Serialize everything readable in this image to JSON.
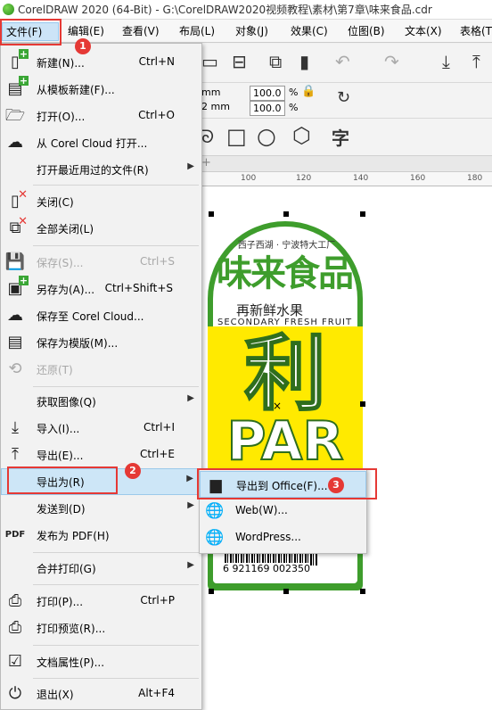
{
  "window": {
    "title": "CorelDRAW 2020 (64-Bit) - G:\\CorelDRAW2020视频教程\\素材\\第7章\\味来食品.cdr"
  },
  "menubar": {
    "items": [
      {
        "label": "文件(F)"
      },
      {
        "label": "编辑(E)"
      },
      {
        "label": "查看(V)"
      },
      {
        "label": "布局(L)"
      },
      {
        "label": "对象(J)"
      },
      {
        "label": "效果(C)"
      },
      {
        "label": "位图(B)"
      },
      {
        "label": "文本(X)"
      },
      {
        "label": "表格(T)"
      }
    ]
  },
  "toolbar": {
    "size_w_unit": "mm",
    "size_h_unit": "2 mm",
    "scale_x": "100.0",
    "scale_y": "100.0",
    "percent": "%",
    "text_tool_glyph": "字"
  },
  "ruler": {
    "labels": [
      "100",
      "120",
      "140",
      "160",
      "180"
    ]
  },
  "artwork": {
    "subtitle": "西子西湖 · 宁波特大工厂",
    "brand": "味来食品",
    "tagline": "再新鲜水果",
    "english": "SECONDARY FRESH FRUIT",
    "big_text": "利",
    "big_text2": "PAR",
    "barcode_number": "6 921169 002350"
  },
  "file_menu": {
    "items": [
      {
        "label": "新建(N)...",
        "shortcut": "Ctrl+N",
        "icon": "new-doc-icon",
        "enabled": true
      },
      {
        "label": "从模板新建(F)...",
        "shortcut": "",
        "icon": "new-from-template-icon",
        "enabled": true
      },
      {
        "label": "打开(O)...",
        "shortcut": "Ctrl+O",
        "icon": "open-folder-icon",
        "enabled": true
      },
      {
        "label": "从 Corel Cloud 打开...",
        "shortcut": "",
        "icon": "cloud-download-icon",
        "enabled": true
      },
      {
        "label": "打开最近用过的文件(R)",
        "shortcut": "",
        "icon": "",
        "enabled": true,
        "submenu": true
      },
      {
        "label": "关闭(C)",
        "shortcut": "",
        "icon": "close-doc-icon",
        "enabled": true
      },
      {
        "label": "全部关闭(L)",
        "shortcut": "",
        "icon": "close-all-icon",
        "enabled": true
      },
      {
        "label": "保存(S)...",
        "shortcut": "Ctrl+S",
        "icon": "save-icon",
        "enabled": false
      },
      {
        "label": "另存为(A)...",
        "shortcut": "Ctrl+Shift+S",
        "icon": "save-as-icon",
        "enabled": true
      },
      {
        "label": "保存至 Corel Cloud...",
        "shortcut": "",
        "icon": "cloud-upload-icon",
        "enabled": true
      },
      {
        "label": "保存为模版(M)...",
        "shortcut": "",
        "icon": "save-template-icon",
        "enabled": true
      },
      {
        "label": "还原(T)",
        "shortcut": "",
        "icon": "revert-icon",
        "enabled": false
      },
      {
        "label": "获取图像(Q)",
        "shortcut": "",
        "icon": "",
        "enabled": true,
        "submenu": true
      },
      {
        "label": "导入(I)...",
        "shortcut": "Ctrl+I",
        "icon": "import-icon",
        "enabled": true
      },
      {
        "label": "导出(E)...",
        "shortcut": "Ctrl+E",
        "icon": "export-icon",
        "enabled": true
      },
      {
        "label": "导出为(R)",
        "shortcut": "",
        "icon": "",
        "enabled": true,
        "submenu": true
      },
      {
        "label": "发送到(D)",
        "shortcut": "",
        "icon": "",
        "enabled": true,
        "submenu": true
      },
      {
        "label": "发布为 PDF(H)",
        "shortcut": "",
        "icon": "pdf-icon",
        "enabled": true
      },
      {
        "label": "合并打印(G)",
        "shortcut": "",
        "icon": "",
        "enabled": true,
        "submenu": true
      },
      {
        "label": "打印(P)...",
        "shortcut": "Ctrl+P",
        "icon": "print-icon",
        "enabled": true
      },
      {
        "label": "打印预览(R)...",
        "shortcut": "",
        "icon": "print-preview-icon",
        "enabled": true
      },
      {
        "label": "文档属性(P)...",
        "shortcut": "",
        "icon": "document-properties-icon",
        "enabled": true
      },
      {
        "label": "退出(X)",
        "shortcut": "Alt+F4",
        "icon": "exit-icon",
        "enabled": true
      }
    ],
    "pdf_icon_text": "PDF"
  },
  "export_submenu": {
    "items": [
      {
        "label": "导出到 Office(F)...",
        "icon": "office-export-icon"
      },
      {
        "label": "Web(W)...",
        "icon": "web-globe-icon"
      },
      {
        "label": "WordPress...",
        "icon": "wordpress-globe-icon"
      }
    ]
  },
  "callouts": {
    "step1": "1",
    "step2": "2",
    "step3": "3"
  },
  "colors": {
    "highlight": "#cde6f7",
    "callout_red": "#e53935",
    "brand_green": "#3e9d2c",
    "label_yellow": "#ffea00"
  }
}
